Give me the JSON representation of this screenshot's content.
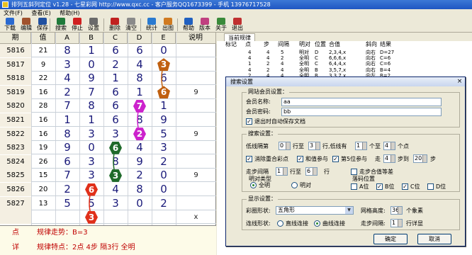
{
  "window": {
    "title": "排列五斜列定位 v1.28 - 七星彩网 http://www.qxc.cc - 客户服务QQ1673399 - 手机 13976717528"
  },
  "menu": [
    "文件(F)",
    "查看(E)",
    "帮助(H)"
  ],
  "toolbar": [
    {
      "label": "下载",
      "icon": "download-icon",
      "color": "#2a6ad0"
    },
    {
      "label": "编辑",
      "icon": "edit-icon",
      "color": "#a0522d"
    },
    {
      "label": "保存",
      "icon": "save-icon",
      "color": "#2050a0"
    },
    {
      "label": "搜索",
      "icon": "search-icon",
      "color": "#1f7a3a"
    },
    {
      "label": "停止",
      "icon": "stop-icon",
      "color": "#d02020"
    },
    {
      "label": "设置",
      "icon": "settings-icon",
      "color": "#6a6a6a"
    },
    {
      "label": "删除",
      "icon": "delete-icon",
      "color": "#c02020"
    },
    {
      "label": "清空",
      "icon": "clear-icon",
      "color": "#8a8a8a"
    },
    {
      "label": "统计",
      "icon": "stats-icon",
      "color": "#2a7ad0"
    },
    {
      "label": "出图",
      "icon": "chart-icon",
      "color": "#d07a20"
    },
    {
      "label": "帮助",
      "icon": "help-icon",
      "color": "#2060c0"
    },
    {
      "label": "版本",
      "icon": "version-icon",
      "color": "#c04080"
    },
    {
      "label": "关于",
      "icon": "about-icon",
      "color": "#3a8a3a"
    },
    {
      "label": "退出",
      "icon": "exit-icon",
      "color": "#c03030"
    }
  ],
  "grid": {
    "headers": [
      "期",
      "值",
      "A",
      "B",
      "C",
      "D",
      "E",
      "说明"
    ],
    "rows": [
      {
        "period": "5816",
        "value": "21",
        "digits": [
          "8",
          "1",
          "6",
          "6",
          "0"
        ],
        "note": ""
      },
      {
        "period": "5817",
        "value": "9",
        "digits": [
          "3",
          "0",
          "2",
          "4",
          "3"
        ],
        "note": ""
      },
      {
        "period": "5818",
        "value": "22",
        "digits": [
          "4",
          "9",
          "1",
          "8",
          "6"
        ],
        "note": ""
      },
      {
        "period": "5819",
        "value": "16",
        "digits": [
          "2",
          "7",
          "6",
          "1",
          "6"
        ],
        "note": "9"
      },
      {
        "period": "5820",
        "value": "28",
        "digits": [
          "7",
          "8",
          "6",
          "7",
          "1"
        ],
        "note": ""
      },
      {
        "period": "5821",
        "value": "16",
        "digits": [
          "1",
          "1",
          "6",
          "8",
          "9"
        ],
        "note": ""
      },
      {
        "period": "5822",
        "value": "16",
        "digits": [
          "8",
          "3",
          "3",
          "2",
          "5"
        ],
        "note": "9"
      },
      {
        "period": "5823",
        "value": "19",
        "digits": [
          "9",
          "0",
          "6",
          "4",
          "3"
        ],
        "note": ""
      },
      {
        "period": "5824",
        "value": "26",
        "digits": [
          "6",
          "3",
          "8",
          "9",
          "2"
        ],
        "note": ""
      },
      {
        "period": "5825",
        "value": "15",
        "digits": [
          "7",
          "3",
          "3",
          "2",
          "0"
        ],
        "note": "9"
      },
      {
        "period": "5826",
        "value": "20",
        "digits": [
          "2",
          "6",
          "4",
          "8",
          "0"
        ],
        "note": ""
      },
      {
        "period": "5827",
        "value": "13",
        "digits": [
          "5",
          "5",
          "3",
          "0",
          "2"
        ],
        "note": ""
      },
      {
        "period": "",
        "value": "",
        "digits": [
          "",
          "",
          "",
          "",
          ""
        ],
        "note": "x"
      }
    ],
    "markers": [
      {
        "row": 1,
        "col": 4,
        "text": "3",
        "shape": "pent",
        "color": "#c06010"
      },
      {
        "row": 3,
        "col": 4,
        "text": "6",
        "shape": "pent",
        "color": "#c06010"
      },
      {
        "row": 4,
        "col": 3,
        "text": "7",
        "shape": "hex",
        "color": "#cc22cc"
      },
      {
        "row": 6,
        "col": 3,
        "text": "2",
        "shape": "hex",
        "color": "#cc22cc"
      },
      {
        "row": 7,
        "col": 2,
        "text": "6",
        "shape": "hex",
        "color": "#1f6a2a"
      },
      {
        "row": 9,
        "col": 2,
        "text": "3",
        "shape": "hex",
        "color": "#1f6a2a"
      },
      {
        "row": 10,
        "col": 1,
        "text": "6",
        "shape": "hex",
        "color": "#e0301a"
      },
      {
        "row": 12,
        "col": 1,
        "text": "3",
        "shape": "hex",
        "color": "#e0301a"
      }
    ]
  },
  "bottom": {
    "row1": {
      "key": "点",
      "value": "规律走势：B=3"
    },
    "row2": {
      "key": "详",
      "value": "规律特点：2点  4步    隔3行  全明"
    }
  },
  "right": {
    "tab": "当前规律",
    "headers": [
      "标记",
      "点",
      "步",
      "间隔",
      "明对",
      "位置",
      "合值",
      "斜向",
      "结果"
    ],
    "rows": [
      [
        "",
        "4",
        "4",
        "5",
        "明对",
        "D",
        "2,3,4,x",
        "向右",
        "D=27"
      ],
      [
        "",
        "4",
        "4",
        "2",
        "全明",
        "C",
        "6,6,6,x",
        "向右",
        "C=6"
      ],
      [
        "",
        "1",
        "2",
        "4",
        "全明",
        "C",
        "6,4,4,x",
        "向右",
        "C=6"
      ],
      [
        "",
        "4",
        "2",
        "4",
        "全明",
        "B",
        "3,5,7,x",
        "向右",
        "B=4"
      ],
      [
        "",
        "2",
        "4",
        "4",
        "全明",
        "B",
        "3,3,7,x",
        "向左",
        "B=2"
      ]
    ]
  },
  "dialog": {
    "title": "搜索设置",
    "member_group": "网站会员设置：",
    "member_name_label": "会员名称:",
    "member_name": "aa",
    "member_pwd_label": "会员密码:",
    "member_pwd": "bb",
    "autosave": "退出时自动保存文档",
    "search_group": "搜索设置：",
    "lowpt_a": "低线隔第",
    "lowpt_v1": "0",
    "lowpt_b": "行至",
    "lowpt_v2": "3",
    "lowpt_c": "行,低线有",
    "lowpt_v3": "1",
    "lowpt_d": "个至",
    "lowpt_v4": "4",
    "lowpt_e": "个点",
    "opt_remove": "消除重合彩点",
    "opt_and": "和值参与",
    "opt_5pos": "第5位参与",
    "opt_step": "走",
    "step_v1": "4",
    "step_to": "步到",
    "step_v2": "20",
    "step_end": "步",
    "interval_label": "走步间隔",
    "interval_v1": "1",
    "interval_to": "行至",
    "interval_v2": "6",
    "interval_end": "行",
    "opt_equal": "走步合值等差",
    "mdtype_group": "明对类型",
    "md_all": "全明",
    "md_pair": "明对",
    "pos_group": "落码位置",
    "pos_a": "A位",
    "pos_b": "B位",
    "pos_c": "C位",
    "pos_d": "D位",
    "display_group": "显示设置：",
    "shape_label": "彩圈形状:",
    "shape_value": "五角形",
    "grid_h_label": "网格高度:",
    "grid_h": "36",
    "grid_h_unit": "个象素",
    "line_label": "连线形状:",
    "line_straight": "直线连接",
    "line_curve": "曲线连接",
    "step_int_label": "走步间隔:",
    "step_int": "1",
    "step_int_unit": "行详显",
    "ok": "确定",
    "cancel": "取消"
  }
}
